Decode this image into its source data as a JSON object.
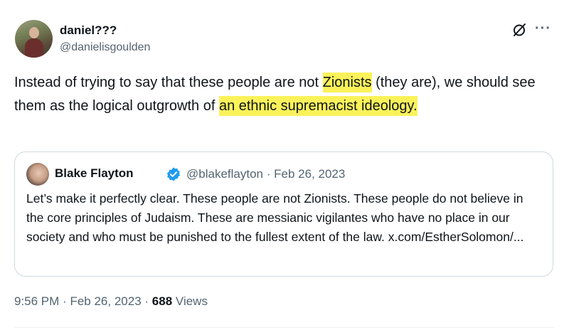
{
  "author": {
    "display_name": "daniel???",
    "handle": "@danielisgoulden"
  },
  "tweet": {
    "text_part1": "Instead of trying to say that these people are not ",
    "highlight1": "Zionists",
    "text_part2": " (they are), we should see them as the logical outgrowth of ",
    "highlight2": "an ethnic supremacist ideology.",
    "highlight_color": "#fbf25a"
  },
  "quoted_tweet": {
    "display_name": "Blake Flayton",
    "handle": "@blakeflayton",
    "separator": "·",
    "date": "Feb 26, 2023",
    "text": "Let’s make it perfectly clear. These people are not Zionists. These people do not believe in the core principles of Judaism. These are messianic vigilantes who have no place in our society and who must be punished to the fullest extent of the law. x.com/EstherSolomon/..."
  },
  "meta": {
    "time": "9:56 PM",
    "separator1": "·",
    "date": "Feb 26, 2023",
    "separator2": "·",
    "views_count": "688",
    "views_label": "Views"
  },
  "icons": {
    "grok": "grok-icon",
    "more": "more-icon",
    "verified": "verified-badge-icon"
  },
  "colors": {
    "verified_blue": "#1d9bf0",
    "secondary_text": "#536471"
  }
}
